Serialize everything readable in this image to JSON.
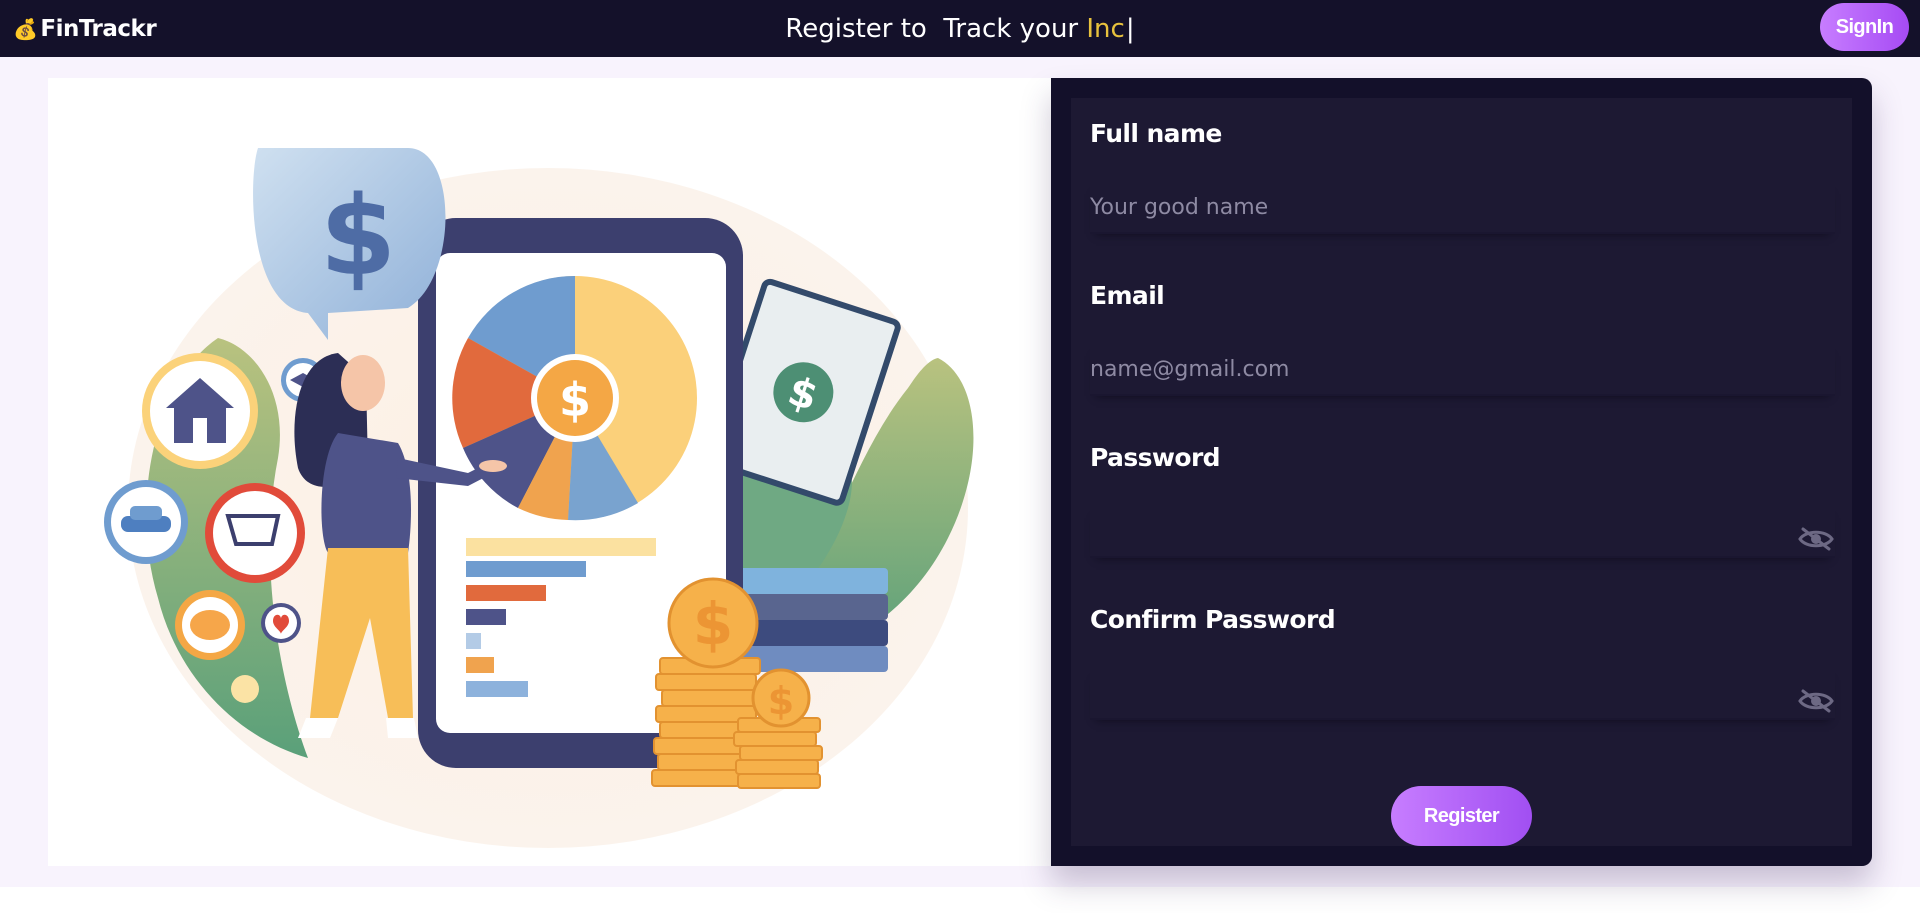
{
  "navbar": {
    "brand_icon": "money-bag-icon",
    "brand_name": "FinTrackr",
    "headline_prefix": "Register to  Track your ",
    "headline_typed": "Inc",
    "headline_caret": "|",
    "signin_label": "SignIn"
  },
  "illustration": {
    "alt": "Woman presenting financial dashboard"
  },
  "form": {
    "fields": [
      {
        "label": "Full name",
        "placeholder": "Your good name",
        "value": ""
      },
      {
        "label": "Email",
        "placeholder": "name@gmail.com",
        "value": ""
      },
      {
        "label": "Password",
        "placeholder": "",
        "value": "",
        "icon": "eye-slash-icon"
      },
      {
        "label": "Confirm Password",
        "placeholder": "",
        "value": "",
        "icon": "eye-slash-icon"
      }
    ],
    "register_label": "Register"
  },
  "colors": {
    "navbar_bg": "#14112a",
    "accent_gradient_start": "#c77dff",
    "accent_gradient_end": "#a64bf4",
    "typed_text": "#e8c23d",
    "form_bg": "#1d1933",
    "page_bg": "#f8f3fd"
  }
}
